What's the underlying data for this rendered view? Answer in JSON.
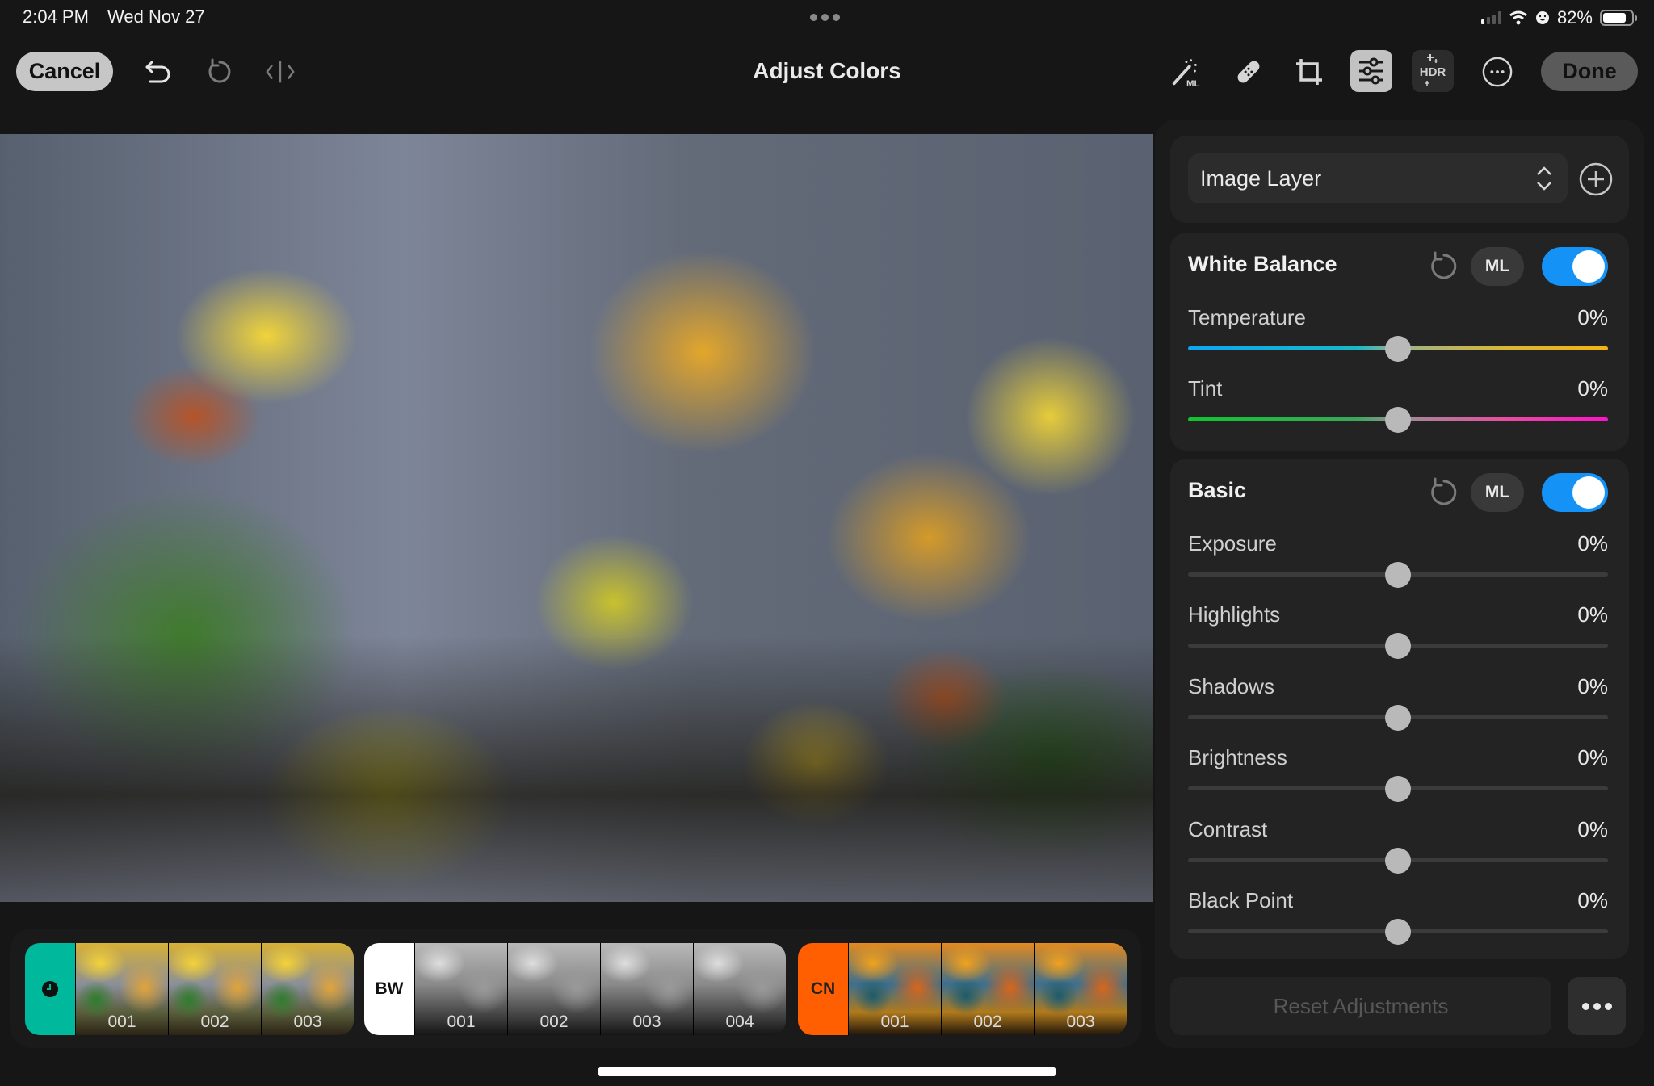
{
  "status_bar": {
    "time": "2:04 PM",
    "date": "Wed Nov 27",
    "battery": "82%",
    "battery_level": 0.82,
    "icons": [
      "signal-icon",
      "wifi-icon",
      "focus-icon",
      "battery-icon"
    ]
  },
  "toolbar": {
    "cancel_label": "Cancel",
    "title": "Adjust Colors",
    "done_label": "Done",
    "left_icons": [
      "undo-icon",
      "revert-icon",
      "compare-icon"
    ],
    "right_icons": [
      "ml-magic-wand-icon",
      "bandage-icon",
      "crop-icon",
      "adjust-sliders-icon",
      "hdr-icon",
      "more-circle-icon"
    ],
    "hdr_label": "HDR",
    "ml_badge": "ML",
    "active_tool": "adjust-sliders"
  },
  "panel": {
    "layer": {
      "selected": "Image Layer"
    },
    "white_balance": {
      "title": "White Balance",
      "ml_label": "ML",
      "enabled": true,
      "sliders": [
        {
          "label": "Temperature",
          "value": "0%",
          "position": 0.5
        },
        {
          "label": "Tint",
          "value": "0%",
          "position": 0.5
        }
      ]
    },
    "basic": {
      "title": "Basic",
      "ml_label": "ML",
      "enabled": true,
      "sliders": [
        {
          "label": "Exposure",
          "value": "0%",
          "position": 0.5
        },
        {
          "label": "Highlights",
          "value": "0%",
          "position": 0.5
        },
        {
          "label": "Shadows",
          "value": "0%",
          "position": 0.5
        },
        {
          "label": "Brightness",
          "value": "0%",
          "position": 0.5
        },
        {
          "label": "Contrast",
          "value": "0%",
          "position": 0.5
        },
        {
          "label": "Black Point",
          "value": "0%",
          "position": 0.5
        }
      ]
    },
    "reset_label": "Reset Adjustments"
  },
  "filmstrip": {
    "groups": [
      {
        "tag": "",
        "tag_icon": "clock-icon",
        "color": "#00b89c",
        "text_color": "#111111",
        "items": [
          "001",
          "002",
          "003"
        ],
        "style": "color"
      },
      {
        "tag": "BW",
        "color": "#ffffff",
        "text_color": "#111111",
        "items": [
          "001",
          "002",
          "003",
          "004"
        ],
        "style": "bw"
      },
      {
        "tag": "CN",
        "color": "#ff5f00",
        "text_color": "#222222",
        "items": [
          "001",
          "002",
          "003"
        ],
        "style": "cn"
      }
    ]
  },
  "colors": {
    "toggle_on": "#1592f6",
    "recent_group": "#00b89c",
    "cn_group": "#ff5f00"
  }
}
